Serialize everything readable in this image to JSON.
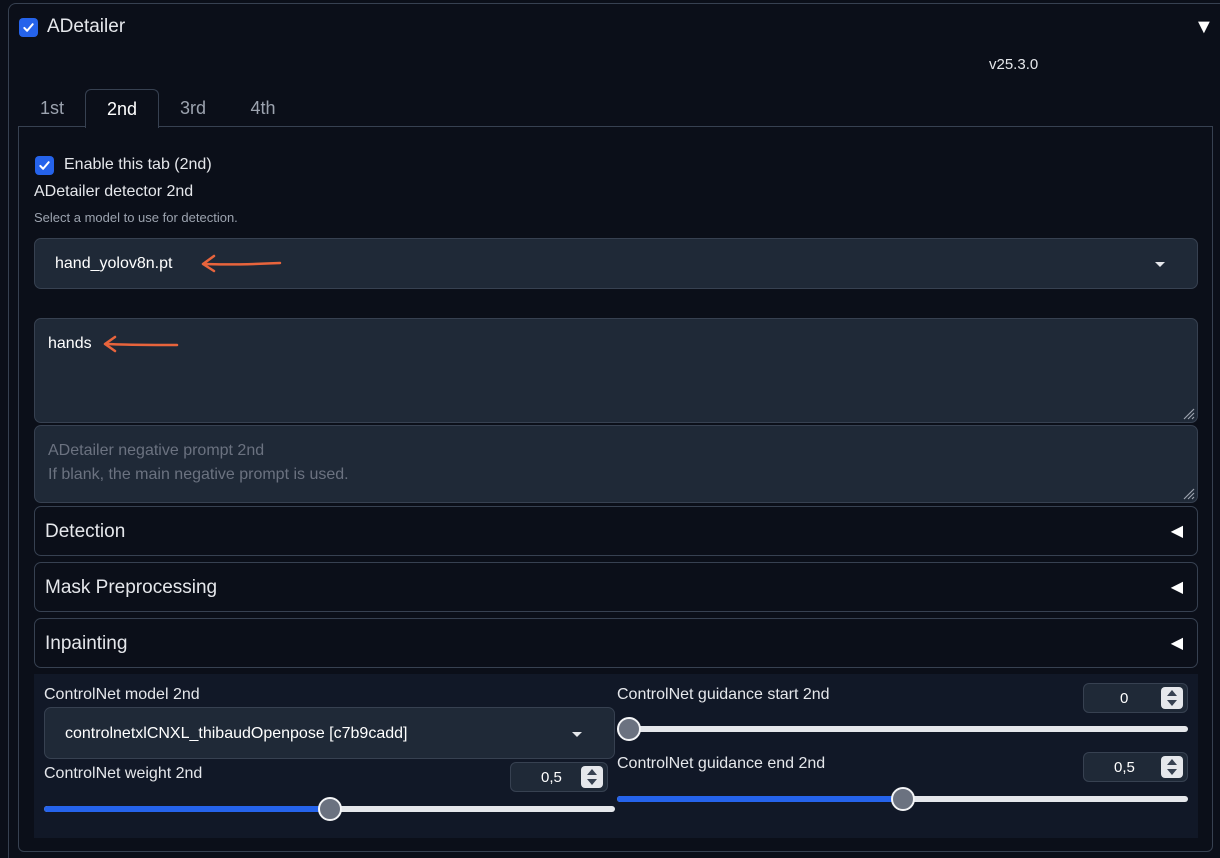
{
  "header": {
    "title": "ADetailer",
    "enabled": true,
    "version": "v25.3.0"
  },
  "tabs": [
    {
      "label": "1st",
      "active": false
    },
    {
      "label": "2nd",
      "active": true
    },
    {
      "label": "3rd",
      "active": false
    },
    {
      "label": "4th",
      "active": false
    }
  ],
  "panel": {
    "enable_label": "Enable this tab (2nd)",
    "detector_label": "ADetailer detector 2nd",
    "detector_info": "Select a model to use for detection.",
    "detector_value": "hand_yolov8n.pt",
    "prompt_value": "hands",
    "negative_placeholder_line1": "ADetailer negative prompt 2nd",
    "negative_placeholder_line2": "If blank, the main negative prompt is used."
  },
  "accordions": {
    "detection": "Detection",
    "mask": "Mask Preprocessing",
    "inpainting": "Inpainting"
  },
  "controlnet": {
    "model_label": "ControlNet model 2nd",
    "model_value": "controlnetxlCNXL_thibaudOpenpose [c7b9cadd]",
    "weight_label": "ControlNet weight 2nd",
    "weight_value": "0,5",
    "weight_fraction": 0.5,
    "start_label": "ControlNet guidance start 2nd",
    "start_value": "0",
    "start_fraction": 0.0,
    "end_label": "ControlNet guidance end 2nd",
    "end_value": "0,5",
    "end_fraction": 0.5
  },
  "colors": {
    "accent": "#2563eb",
    "annotation_arrow": "#e8643c"
  }
}
